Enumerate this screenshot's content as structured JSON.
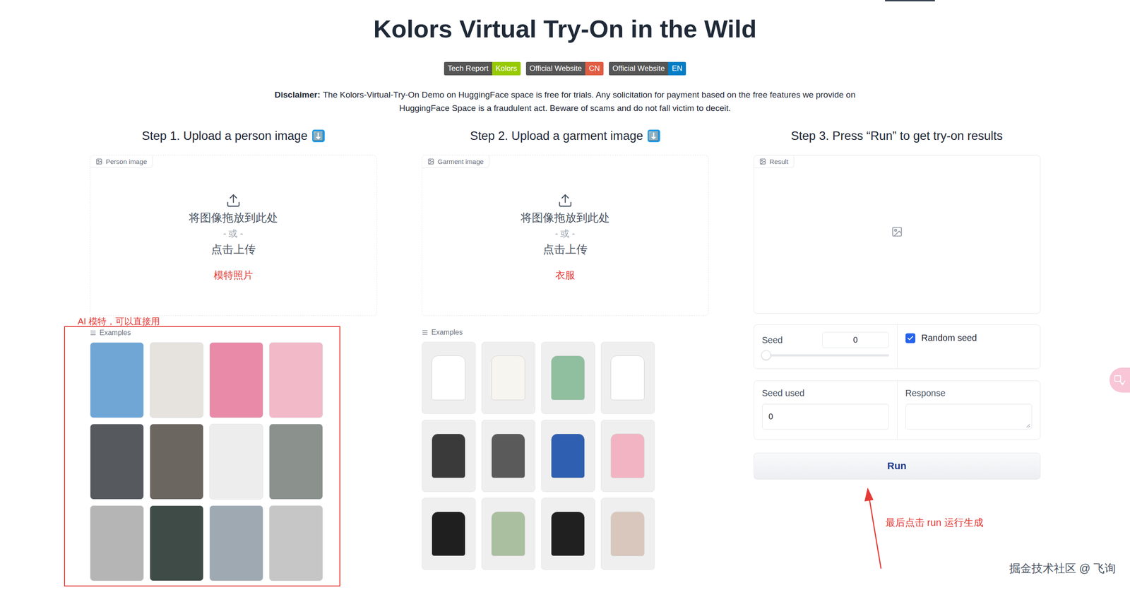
{
  "title": "Kolors Virtual Try-On in the Wild",
  "badges": [
    {
      "label": "Tech Report",
      "value": "Kolors",
      "color": "#97ca00"
    },
    {
      "label": "Official Website",
      "value": "CN",
      "color": "#e05d44"
    },
    {
      "label": "Official Website",
      "value": "EN",
      "color": "#007ec6"
    }
  ],
  "disclaimer": {
    "label": "Disclaimer:",
    "text": "The Kolors-Virtual-Try-On Demo on HuggingFace space is free for trials. Any solicitation for payment based on the free features we provide on HuggingFace Space is a fraudulent act. Beware of scams and do not fall victim to deceit."
  },
  "person": {
    "heading": "Step 1. Upload a person image",
    "icon": "⬇️",
    "panel": {
      "label": "Person image",
      "drop": "将图像拖放到此处",
      "or": "- 或 -",
      "click": "点击上传",
      "note": "模特照片"
    },
    "annotation": "AI 模特，可以直接用",
    "examples": {
      "label": "Examples",
      "items": [
        {
          "color": "#6fa6d6"
        },
        {
          "color": "#e6e2de"
        },
        {
          "color": "#e98aa8"
        },
        {
          "color": "#f2b9c8"
        },
        {
          "color": "#56595e"
        },
        {
          "color": "#6b6660"
        },
        {
          "color": "#ededed"
        },
        {
          "color": "#8b918d"
        },
        {
          "color": "#b5b5b5"
        },
        {
          "color": "#3e4b46"
        },
        {
          "color": "#9ea9b2"
        },
        {
          "color": "#c6c6c6"
        }
      ]
    }
  },
  "garment": {
    "heading": "Step 2. Upload a garment image",
    "icon": "⬇️",
    "panel": {
      "label": "Garment image",
      "drop": "将图像拖放到此处",
      "or": "- 或 -",
      "click": "点击上传",
      "note": "衣服"
    },
    "examples": {
      "label": "Examples",
      "items": [
        {
          "color": "#ffffff"
        },
        {
          "color": "#f7f5ef"
        },
        {
          "color": "#8fbf9f"
        },
        {
          "color": "#ffffff"
        },
        {
          "color": "#3a3a3a"
        },
        {
          "color": "#5a5a5a"
        },
        {
          "color": "#2f5fb0"
        },
        {
          "color": "#f2b3c2"
        },
        {
          "color": "#1f1f1f"
        },
        {
          "color": "#a9bfa0"
        },
        {
          "color": "#202020"
        },
        {
          "color": "#d9c7bd"
        }
      ]
    }
  },
  "result": {
    "heading": "Step 3. Press “Run” to get try-on results",
    "label": "Result",
    "seed": {
      "label": "Seed",
      "value": "0",
      "level": 0
    },
    "random_seed": {
      "label": "Random seed",
      "checked": true
    },
    "seed_used": {
      "label": "Seed used",
      "value": "0"
    },
    "response": {
      "label": "Response",
      "value": ""
    },
    "run": "Run",
    "annotation": "最后点击 run 运行生成"
  },
  "watermark": "掘金技术社区 @ 飞询"
}
